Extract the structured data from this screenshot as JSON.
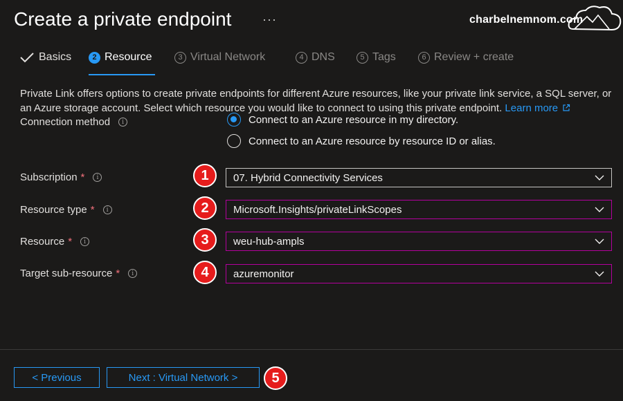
{
  "header": {
    "title": "Create a private endpoint",
    "more": "···",
    "watermark": "charbelnemnom.com"
  },
  "tabs": [
    {
      "num": "",
      "label": "Basics"
    },
    {
      "num": "2",
      "label": "Resource"
    },
    {
      "num": "3",
      "label": "Virtual Network"
    },
    {
      "num": "4",
      "label": "DNS"
    },
    {
      "num": "5",
      "label": "Tags"
    },
    {
      "num": "6",
      "label": "Review + create"
    }
  ],
  "description": {
    "text": "Private Link offers options to create private endpoints for different Azure resources, like your private link service, a SQL server, or an Azure storage account. Select which resource you would like to connect to using this private endpoint.",
    "link": "Learn more"
  },
  "connection": {
    "label": "Connection method",
    "options": [
      "Connect to an Azure resource in my directory.",
      "Connect to an Azure resource by resource ID or alias."
    ]
  },
  "fields": {
    "subscription": {
      "label": "Subscription",
      "value": "07. Hybrid Connectivity Services",
      "badge": "1"
    },
    "resource_type": {
      "label": "Resource type",
      "value": "Microsoft.Insights/privateLinkScopes",
      "badge": "2"
    },
    "resource": {
      "label": "Resource",
      "value": "weu-hub-ampls",
      "badge": "3"
    },
    "target": {
      "label": "Target sub-resource",
      "value": "azuremonitor",
      "badge": "4"
    }
  },
  "required_mark": "*",
  "info_glyph": "i",
  "footer": {
    "previous": "< Previous",
    "next": "Next : Virtual Network >",
    "badge": "5"
  },
  "colors": {
    "accent": "#2899f5",
    "background": "#1b1a19",
    "badge": "#e61c1c",
    "required": "#f1707b",
    "focus": "#b4009e"
  }
}
